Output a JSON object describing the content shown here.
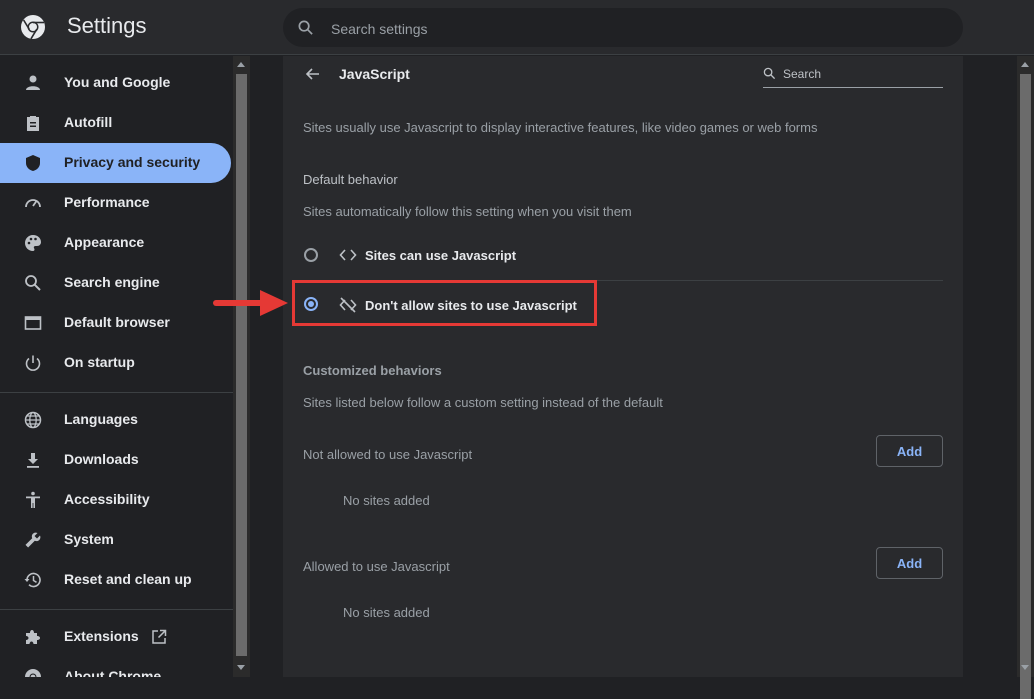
{
  "header": {
    "title": "Settings",
    "search_placeholder": "Search settings"
  },
  "sidebar": {
    "items": [
      {
        "label": "You and Google",
        "icon": "person-icon"
      },
      {
        "label": "Autofill",
        "icon": "clipboard-icon"
      },
      {
        "label": "Privacy and security",
        "icon": "shield-icon",
        "active": true
      },
      {
        "label": "Performance",
        "icon": "speedometer-icon"
      },
      {
        "label": "Appearance",
        "icon": "palette-icon"
      },
      {
        "label": "Search engine",
        "icon": "search-icon"
      },
      {
        "label": "Default browser",
        "icon": "browser-window-icon"
      },
      {
        "label": "On startup",
        "icon": "power-icon"
      },
      {
        "label": "Languages",
        "icon": "globe-icon"
      },
      {
        "label": "Downloads",
        "icon": "download-icon"
      },
      {
        "label": "Accessibility",
        "icon": "accessibility-icon"
      },
      {
        "label": "System",
        "icon": "wrench-icon"
      },
      {
        "label": "Reset and clean up",
        "icon": "history-icon"
      },
      {
        "label": "Extensions",
        "icon": "puzzle-icon"
      },
      {
        "label": "About Chrome",
        "icon": "chrome-icon"
      }
    ]
  },
  "page": {
    "title": "JavaScript",
    "search_placeholder": "Search",
    "description": "Sites usually use Javascript to display interactive features, like video games or web forms",
    "default_behavior": {
      "heading": "Default behavior",
      "subtext": "Sites automatically follow this setting when you visit them",
      "options": [
        {
          "label": "Sites can use Javascript",
          "icon": "code-icon",
          "selected": false
        },
        {
          "label": "Don't allow sites to use Javascript",
          "icon": "code-off-icon",
          "selected": true
        }
      ]
    },
    "customized": {
      "heading": "Customized behaviors",
      "subtext": "Sites listed below follow a custom setting instead of the default",
      "not_allowed": {
        "label": "Not allowed to use Javascript",
        "add_label": "Add",
        "empty": "No sites added"
      },
      "allowed": {
        "label": "Allowed to use Javascript",
        "add_label": "Add",
        "empty": "No sites added"
      }
    }
  },
  "colors": {
    "accent": "#8ab4f8",
    "background": "#202124",
    "surface": "#292a2d",
    "annotation": "#e53935"
  }
}
